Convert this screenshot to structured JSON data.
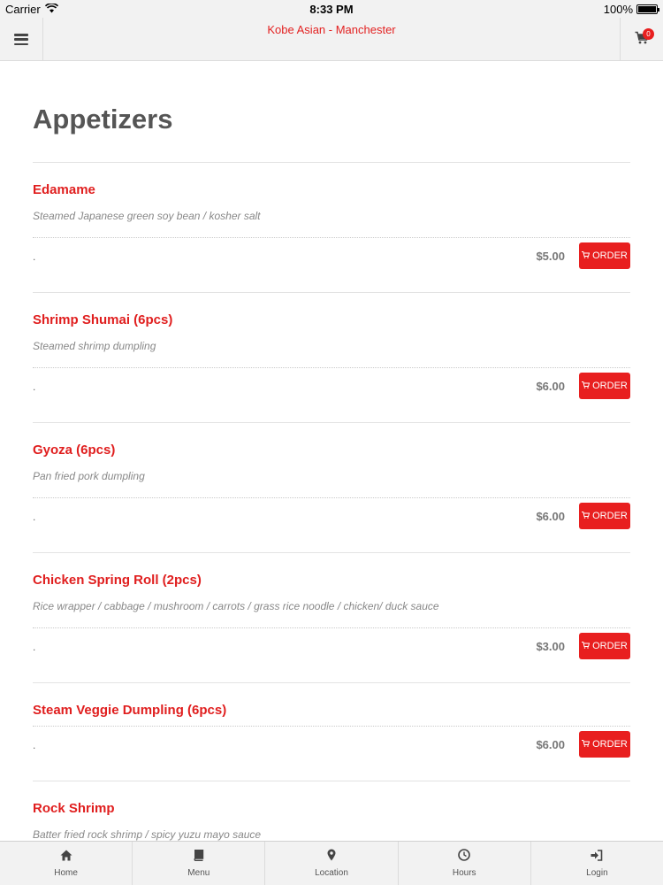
{
  "status_bar": {
    "carrier": "Carrier",
    "time": "8:33 PM",
    "battery": "100%"
  },
  "header": {
    "title": "Kobe Asian - Manchester",
    "cart_count": "0"
  },
  "section": {
    "title": "Appetizers"
  },
  "items": [
    {
      "name": "Edamame",
      "description": "Steamed Japanese green soy bean / kosher salt",
      "dot": ".",
      "price": "$5.00",
      "order_label": "ORDER"
    },
    {
      "name": "Shrimp Shumai (6pcs)",
      "description": "Steamed shrimp dumpling",
      "dot": ".",
      "price": "$6.00",
      "order_label": "ORDER"
    },
    {
      "name": "Gyoza (6pcs)",
      "description": "Pan fried pork dumpling",
      "dot": ".",
      "price": "$6.00",
      "order_label": "ORDER"
    },
    {
      "name": "Chicken Spring Roll (2pcs)",
      "description": "Rice wrapper / cabbage / mushroom / carrots / grass rice noodle / chicken/ duck sauce",
      "dot": ".",
      "price": "$3.00",
      "order_label": "ORDER"
    },
    {
      "name": "Steam Veggie Dumpling (6pcs)",
      "description": "",
      "dot": ".",
      "price": "$6.00",
      "order_label": "ORDER"
    },
    {
      "name": "Rock Shrimp",
      "description": "Batter fried rock shrimp / spicy yuzu mayo sauce",
      "dot": "",
      "price": "",
      "order_label": ""
    }
  ],
  "tabs": [
    {
      "label": "Home",
      "icon": "home-icon"
    },
    {
      "label": "Menu",
      "icon": "book-icon"
    },
    {
      "label": "Location",
      "icon": "map-pin-icon"
    },
    {
      "label": "Hours",
      "icon": "clock-icon"
    },
    {
      "label": "Login",
      "icon": "sign-in-icon"
    }
  ],
  "colors": {
    "accent": "#e81f1f",
    "title_text": "#e01e1e",
    "chrome": "#f2f2f2"
  }
}
